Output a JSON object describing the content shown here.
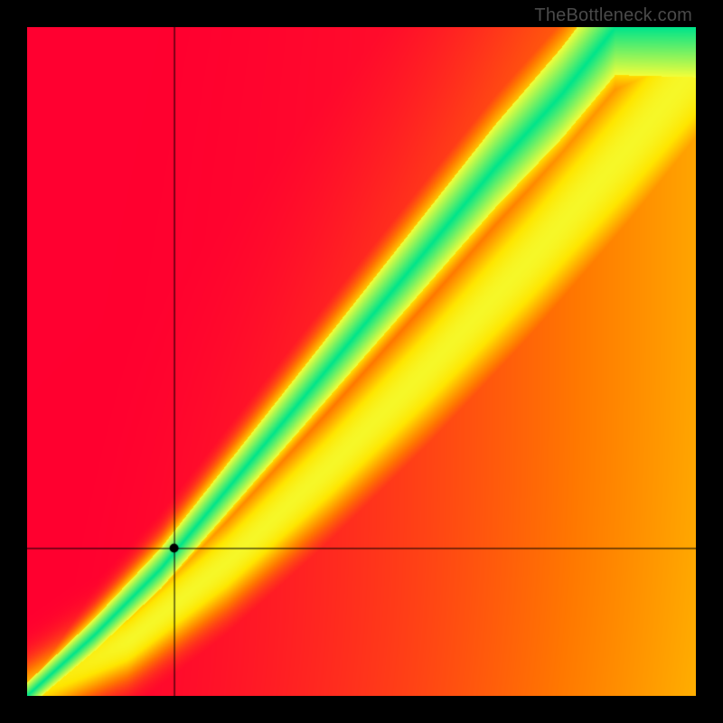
{
  "attribution": "TheBottleneck.com",
  "chart_data": {
    "type": "heatmap",
    "title": "",
    "xlabel": "",
    "ylabel": "",
    "xlim": [
      0,
      1
    ],
    "ylim": [
      0,
      1
    ],
    "crosshair": {
      "x": 0.22,
      "y": 0.22
    },
    "marker": {
      "x": 0.22,
      "y": 0.22
    },
    "ideal_ridge": {
      "description": "Green optimal diagonal band; slight upward curvature; secondary yellow ridge to the right",
      "points_xy": [
        [
          0.0,
          0.0
        ],
        [
          0.1,
          0.09
        ],
        [
          0.2,
          0.19
        ],
        [
          0.3,
          0.31
        ],
        [
          0.4,
          0.43
        ],
        [
          0.5,
          0.55
        ],
        [
          0.6,
          0.67
        ],
        [
          0.7,
          0.79
        ],
        [
          0.8,
          0.9
        ],
        [
          0.88,
          1.0
        ]
      ],
      "secondary_points_xy": [
        [
          0.0,
          0.0
        ],
        [
          0.15,
          0.08
        ],
        [
          0.3,
          0.2
        ],
        [
          0.45,
          0.34
        ],
        [
          0.6,
          0.49
        ],
        [
          0.75,
          0.65
        ],
        [
          0.9,
          0.82
        ],
        [
          1.0,
          0.94
        ]
      ]
    },
    "colorscale": {
      "low": "#ff0030",
      "mid_low": "#ff7a00",
      "mid": "#ffe600",
      "mid_high": "#f3ff3a",
      "ridge": "#00e58b",
      "high_corner": "#ffff66"
    },
    "grid": false,
    "legend": false
  }
}
